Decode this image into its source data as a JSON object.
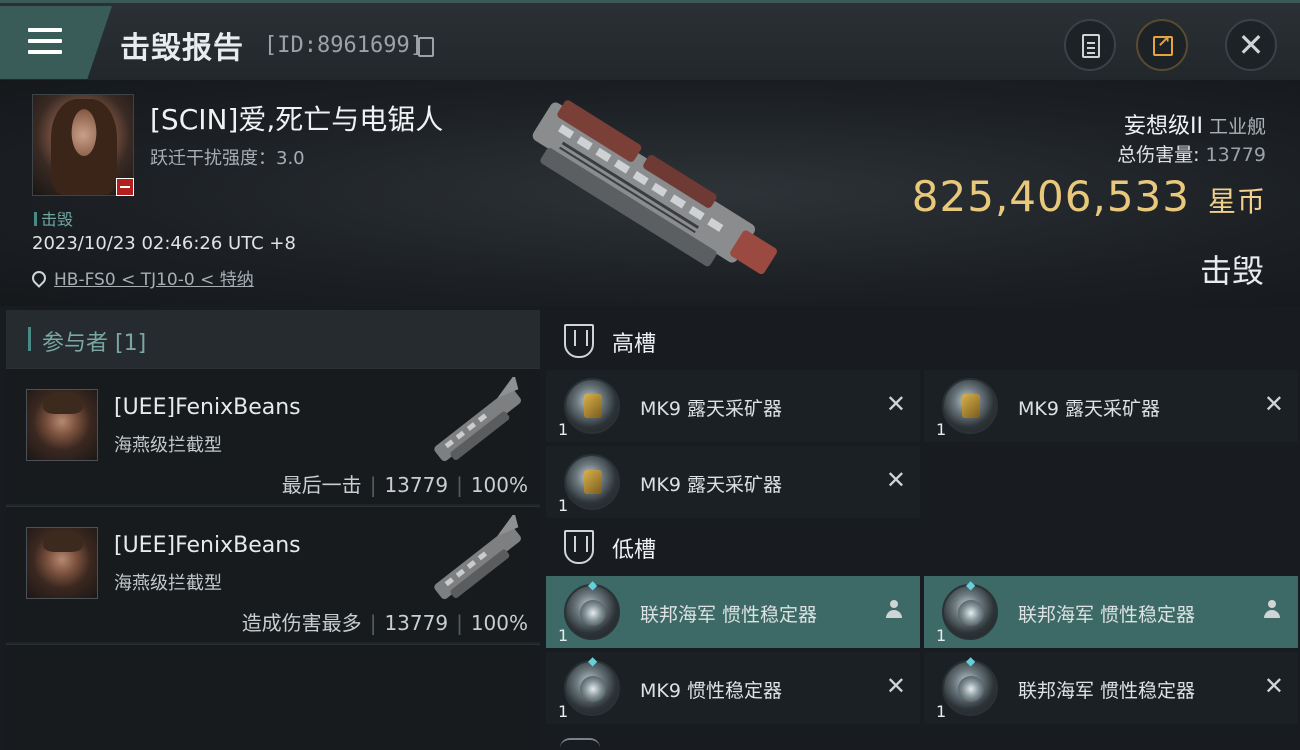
{
  "header": {
    "title": "击毁报告",
    "report_id": "[ID:8961699]"
  },
  "victim": {
    "name": "[SCIN]爱,死亡与电锯人",
    "warp_disruption": "跃迁干扰强度：3.0",
    "kill_tag": "击毁",
    "datetime": "2023/10/23 02:46:26 UTC +8",
    "location": "HB-FS0 < TJ10-0 < 特纳"
  },
  "ship": {
    "name": "妄想级II",
    "class": "工业舰",
    "total_damage_label": "总伤害量:",
    "total_damage": "13779",
    "isk_value": "825,406,533",
    "isk_unit": "星币",
    "status": "击毁"
  },
  "participants": {
    "header": "参与者 [1]",
    "rows": [
      {
        "name": "[UEE]FenixBeans",
        "ship": "海燕级拦截型",
        "role": "最后一击",
        "damage": "13779",
        "percent": "100%"
      },
      {
        "name": "[UEE]FenixBeans",
        "ship": "海燕级拦截型",
        "role": "造成伤害最多",
        "damage": "13779",
        "percent": "100%"
      }
    ]
  },
  "fitting": {
    "high_slots_label": "高槽",
    "high_slots": [
      {
        "name": "MK9 露天采矿器",
        "qty": "1",
        "icon": "strip-miner-icon",
        "state": "destroyed"
      },
      {
        "name": "MK9 露天采矿器",
        "qty": "1",
        "icon": "strip-miner-icon",
        "state": "destroyed"
      },
      {
        "name": "MK9 露天采矿器",
        "qty": "1",
        "icon": "strip-miner-icon",
        "state": "destroyed"
      }
    ],
    "low_slots_label": "低槽",
    "low_slots": [
      {
        "name": "联邦海军 惯性稳定器",
        "qty": "1",
        "icon": "inertial-stabilizer-icon",
        "state": "dropped"
      },
      {
        "name": "联邦海军 惯性稳定器",
        "qty": "1",
        "icon": "inertial-stabilizer-icon",
        "state": "dropped"
      },
      {
        "name": "MK9 惯性稳定器",
        "qty": "1",
        "icon": "inertial-stabilizer-icon",
        "state": "destroyed"
      },
      {
        "name": "联邦海军 惯性稳定器",
        "qty": "1",
        "icon": "inertial-stabilizer-icon",
        "state": "destroyed"
      }
    ]
  },
  "colors": {
    "accent": "#3d6a66",
    "isk_gold": "#e8c87a",
    "badge_red": "#b31e1e"
  }
}
